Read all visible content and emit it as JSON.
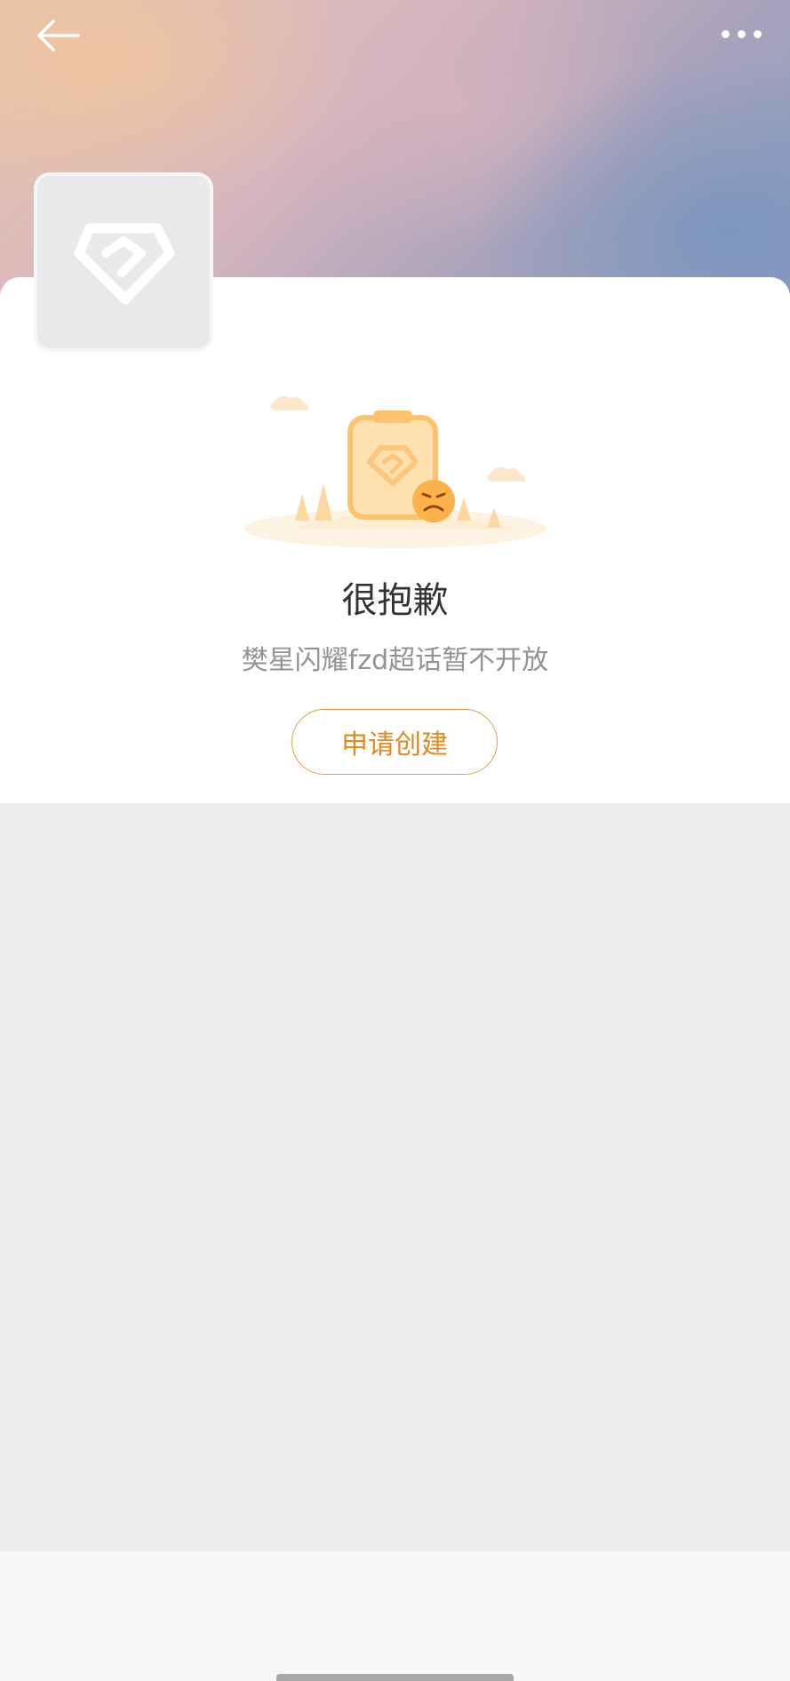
{
  "header": {
    "back_icon": "arrow-left-icon",
    "more_icon": "more-dots-icon"
  },
  "avatar": {
    "icon": "diamond-icon"
  },
  "empty_state": {
    "illustration": "clipboard-sad-face-illustration",
    "title": "很抱歉",
    "message": "樊星闪耀fzd超话暂不开放",
    "apply_button": "申请创建"
  },
  "colors": {
    "accent": "#e08a1e",
    "button_border": "#e2a04a",
    "title": "#333333",
    "message": "#939393",
    "background_gray": "#ececec"
  }
}
